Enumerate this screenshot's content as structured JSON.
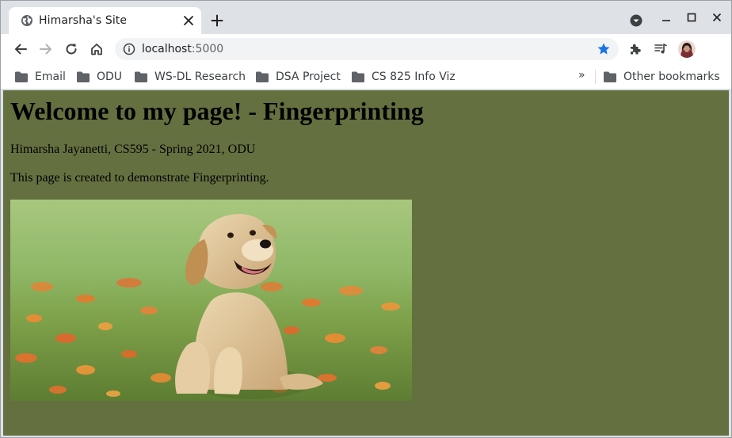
{
  "browser": {
    "tab": {
      "title": "Himarsha's Site"
    },
    "address": {
      "host": "localhost",
      "port": ":5000"
    },
    "bookmarks": [
      {
        "label": "Email"
      },
      {
        "label": "ODU"
      },
      {
        "label": "WS-DL Research"
      },
      {
        "label": "DSA Project"
      },
      {
        "label": "CS 825 Info Viz"
      }
    ],
    "bookmarks_overflow": "»",
    "other_bookmarks": "Other bookmarks"
  },
  "page": {
    "heading": "Welcome to my page! - Fingerprinting",
    "author": "Himarsha Jayanetti, CS595 - Spring 2021, ODU",
    "description": "This page is created to demonstrate Fingerprinting."
  },
  "colors": {
    "page_background": "#647040",
    "bookmark_star": "#1a73e8"
  },
  "icons": [
    "globe-icon",
    "close-icon",
    "plus-icon",
    "tab-search-icon",
    "minimize-icon",
    "maximize-icon",
    "back-icon",
    "forward-icon",
    "reload-icon",
    "home-icon",
    "info-icon",
    "star-icon",
    "extensions-icon",
    "media-control-icon",
    "folder-icon"
  ]
}
